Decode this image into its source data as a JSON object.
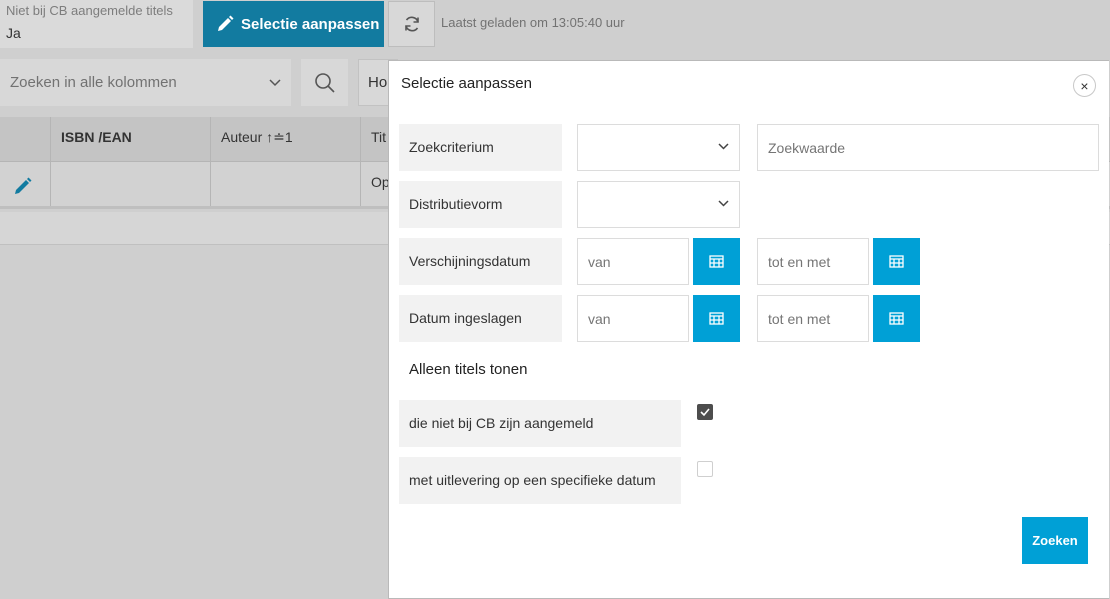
{
  "background": {
    "filter_chip": {
      "label": "Niet bij CB aangemelde titels",
      "value": "Ja"
    },
    "edit_selection_button": "Selectie aanpassen",
    "last_loaded": "Laatst geladen om 13:05:40 uur",
    "search_select_placeholder": "Zoeken in alle kolommen",
    "ho_select_value": "Ho",
    "grid": {
      "columns": [
        "ISBN /EAN",
        "Auteur ↑≐1",
        "Tit"
      ],
      "row": {
        "title_cell": "Op"
      }
    }
  },
  "modal": {
    "title": "Selectie aanpassen",
    "close_label": "×",
    "zoekcriterium": {
      "label": "Zoekcriterium",
      "value_placeholder": "Zoekwaarde"
    },
    "distributievorm": {
      "label": "Distributievorm"
    },
    "verschijningsdatum": {
      "label": "Verschijningsdatum",
      "from_placeholder": "van",
      "to_placeholder": "tot en met"
    },
    "datum_ingeslagen": {
      "label": "Datum ingeslagen",
      "from_placeholder": "van",
      "to_placeholder": "tot en met"
    },
    "section_title": "Alleen titels tonen",
    "options": [
      {
        "label": "die niet bij CB zijn aangemeld",
        "checked": true
      },
      {
        "label": "met uitlevering op een specifieke datum",
        "checked": false
      }
    ],
    "submit_label": "Zoeken"
  },
  "colors": {
    "primary": "#00a0d6",
    "primary_dimmed": "#127ba0",
    "overlay": "#cfcfcf"
  }
}
